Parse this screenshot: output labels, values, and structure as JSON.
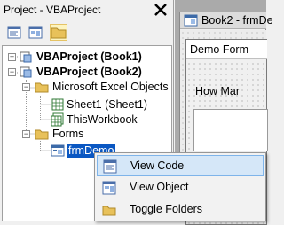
{
  "project_pane": {
    "title": "Project - VBAProject",
    "close_glyph": "✕",
    "toolbar": [
      {
        "name": "view-code-toolbar-icon"
      },
      {
        "name": "view-object-toolbar-icon"
      },
      {
        "name": "toggle-folders-toolbar-icon",
        "active": true
      }
    ],
    "tree": [
      {
        "label": "VBAProject (Book1)",
        "bold": true,
        "icon": "vba-project-icon",
        "expander": "+"
      },
      {
        "label": "VBAProject (Book2)",
        "bold": true,
        "icon": "vba-project-icon",
        "expander": "−"
      },
      {
        "label": "Microsoft Excel Objects",
        "icon": "folder-icon",
        "expander": "−"
      },
      {
        "label": "Sheet1 (Sheet1)",
        "icon": "worksheet-icon"
      },
      {
        "label": "ThisWorkbook",
        "icon": "workbook-icon"
      },
      {
        "label": "Forms",
        "icon": "folder-icon",
        "expander": "−"
      },
      {
        "label": "frmDemo",
        "icon": "userform-icon",
        "selected": true
      }
    ]
  },
  "editor": {
    "window_title": "Book2 - frmDe",
    "form_caption": "Demo Form",
    "label_text": "How Mar"
  },
  "context_menu": {
    "items": [
      {
        "label": "View Code",
        "icon": "view-code-icon",
        "hover": true
      },
      {
        "label": "View Object",
        "icon": "view-object-icon"
      },
      {
        "label": "Toggle Folders",
        "icon": "folder-icon"
      }
    ]
  },
  "colors": {
    "selection": "#0a57c2",
    "menu_hover": "#d5e7f8",
    "folder": "#e8c15a"
  }
}
